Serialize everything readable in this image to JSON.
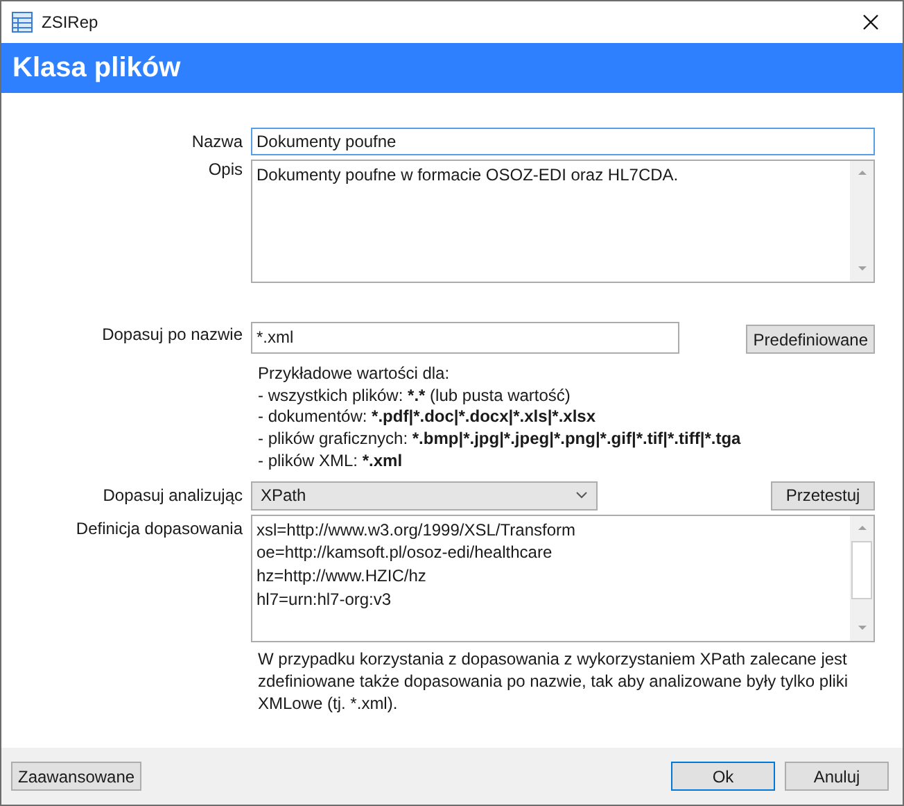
{
  "window": {
    "title": "ZSIRep"
  },
  "header": {
    "title": "Klasa plików"
  },
  "name": {
    "label": "Nazwa",
    "value": "Dokumenty poufne",
    "focused": true
  },
  "description": {
    "label": "Opis",
    "value": "Dokumenty poufne w formacie OSOZ-EDI oraz HL7CDA."
  },
  "name_pattern": {
    "label": "Dopasuj po nazwie",
    "value": "*.xml",
    "button": "Predefiniowane",
    "hints": [
      [
        {
          "text": "Przykładowe wartości dla:",
          "bold": false
        }
      ],
      [
        {
          "text": "- wszystkich plików: ",
          "bold": false
        },
        {
          "text": "*.*",
          "bold": true
        },
        {
          "text": " (lub pusta wartość)",
          "bold": false
        }
      ],
      [
        {
          "text": "- dokumentów: ",
          "bold": false
        },
        {
          "text": "*.pdf|*.doc|*.docx|*.xls|*.xlsx",
          "bold": true
        }
      ],
      [
        {
          "text": "- plików graficznych: ",
          "bold": false
        },
        {
          "text": "*.bmp|*.jpg|*.jpeg|*.png|*.gif|*.tif|*.tiff|*.tga",
          "bold": true
        }
      ],
      [
        {
          "text": "- plików XML: ",
          "bold": false
        },
        {
          "text": "*.xml",
          "bold": true
        }
      ]
    ]
  },
  "analyzer": {
    "label": "Dopasuj analizując",
    "value": "XPath",
    "button": "Przetestuj"
  },
  "definition": {
    "label": "Definicja dopasowania",
    "lines": [
      "xsl=http://www.w3.org/1999/XSL/Transform",
      "oe=http://kamsoft.pl/osoz-edi/healthcare",
      "hz=http://www.HZIC/hz",
      "hl7=urn:hl7-org:v3"
    ]
  },
  "note": "W przypadku korzystania z dopasowania z wykorzystaniem XPath zalecane jest zdefiniowane także dopasowania po nazwie, tak aby analizowane były tylko pliki XMLowe (tj. *.xml).",
  "footer": {
    "left_buttons": [
      {
        "label": "Zaawansowane",
        "default": false
      }
    ],
    "right_buttons": [
      {
        "label": "Ok",
        "default": true
      },
      {
        "label": "Anuluj",
        "default": false
      }
    ]
  }
}
